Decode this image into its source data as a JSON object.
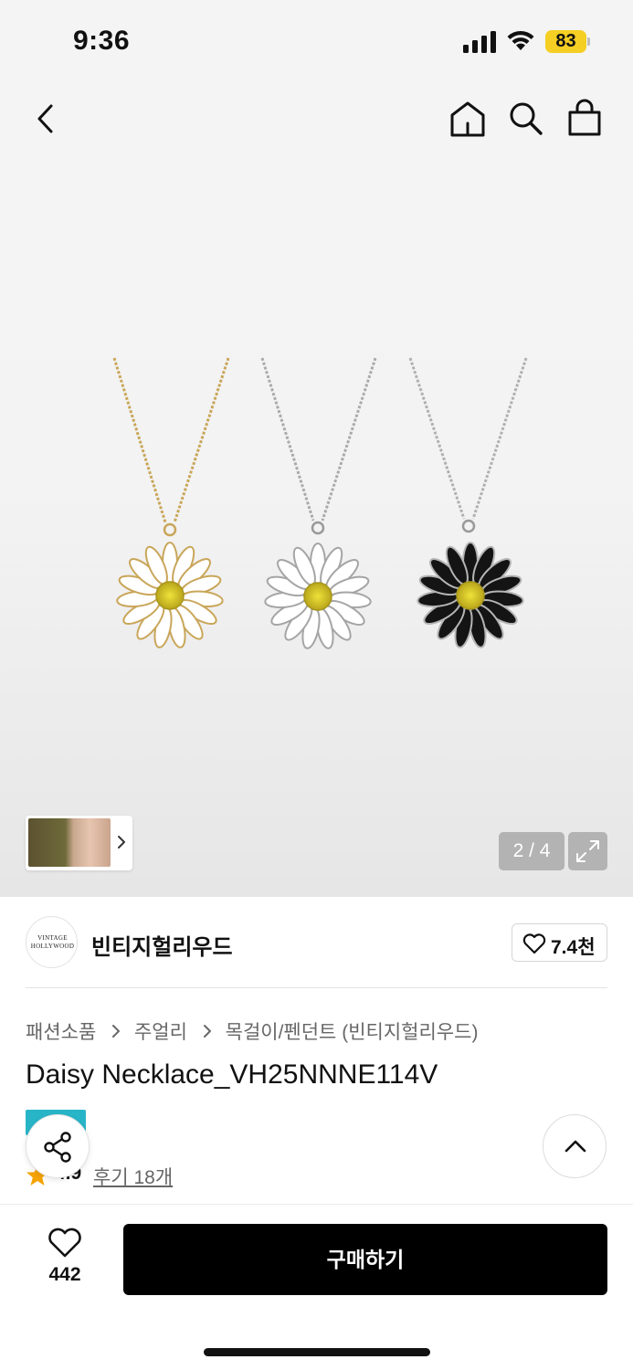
{
  "status_bar": {
    "time": "9:36",
    "battery": "83",
    "battery_color": "#f5cf23"
  },
  "nav": {
    "icons": [
      "back-arrow-icon",
      "home-icon",
      "search-icon",
      "shopping-bag-icon"
    ]
  },
  "gallery": {
    "page_indicator": "2 / 4",
    "pendant_colors": [
      "gold",
      "silver",
      "black"
    ],
    "icons": [
      "chevron-right-icon",
      "expand-icon"
    ]
  },
  "brand": {
    "logo_text": "VINTAGE HOLLYWOOD",
    "name": "빈티지헐리우드",
    "favorite_count": "7.4천"
  },
  "breadcrumb": {
    "items": [
      "패션소품",
      "주얼리",
      "목걸이/펜던트 (빈티지헐리우드)"
    ]
  },
  "product": {
    "title": "Daisy Necklace_VH25NNNE114V",
    "badge_color": "#29b5c8",
    "rating": "4.9",
    "reviews": "후기 18개"
  },
  "bottom_bar": {
    "like_count": "442",
    "buy_label": "구매하기"
  }
}
